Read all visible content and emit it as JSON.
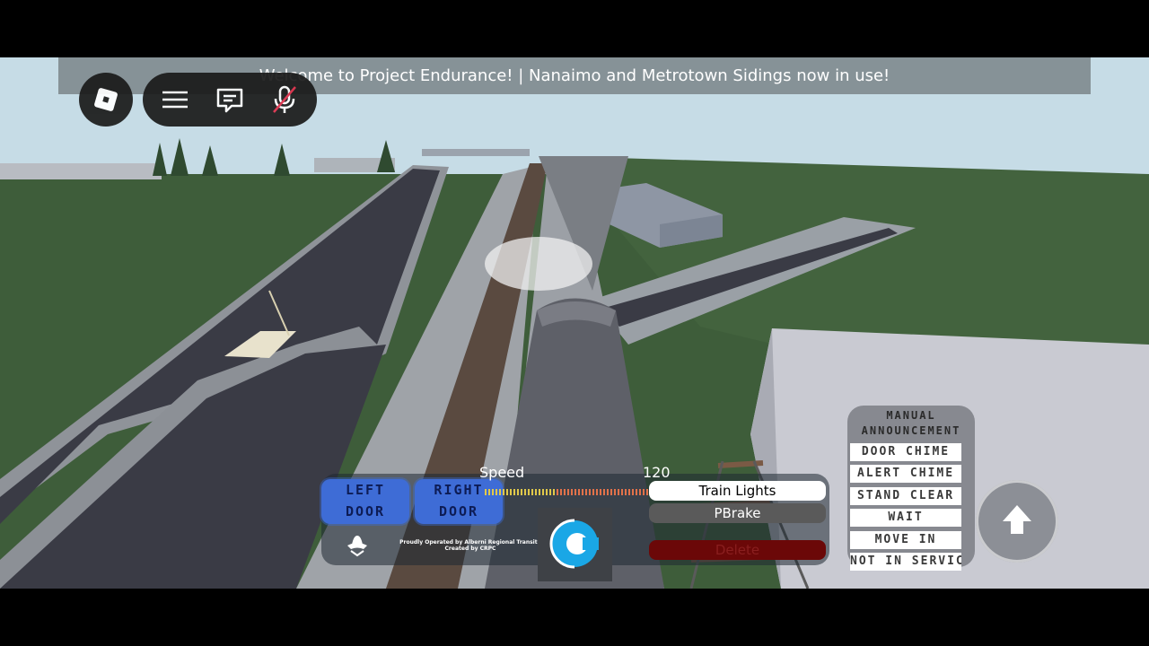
{
  "game": {
    "banner_text": "Welcome to Project Endurance! | Nanaimo and Metrotown Sidings now in use!"
  },
  "roblox_topbar": {
    "logo_icon": "roblox-logo-icon",
    "menu_icon": "hamburger-menu-icon",
    "chat_icon": "chat-icon",
    "mic_icon": "microphone-muted-icon"
  },
  "train_hud": {
    "left_door": "LEFT\nDOOR",
    "right_door": "RIGHT\nDOOR",
    "speed_label": "Speed",
    "speed_max": "120",
    "credits": "Proudly Operated by Alberni Regional Transit | Created by CRPC",
    "train_lights": "Train Lights",
    "pbrake": "PBrake",
    "delete": "Delete",
    "operator_icon": "operator-hat-icon",
    "crpc_logo": "crpc-c-logo-icon"
  },
  "announcements": {
    "title": "MANUAL\nANNOUNCEMENT",
    "items": [
      "DOOR CHIME",
      "ALERT CHIME",
      "STAND CLEAR",
      "WAIT",
      "MOVE IN",
      "NOT IN SERVICE"
    ]
  },
  "controls": {
    "jump_icon": "jump-arrow-icon"
  },
  "colors": {
    "door_button": "#3e6cd6",
    "delete_button": "#6b0808",
    "sky": "#c4dbe6",
    "grass": "#3f5f3c"
  }
}
